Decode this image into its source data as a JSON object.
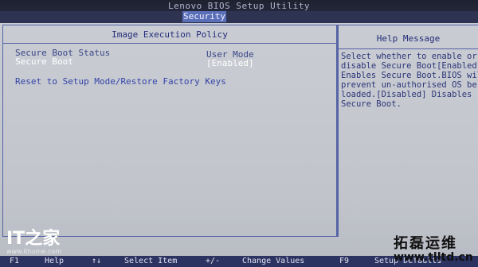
{
  "title": "Lenovo BIOS Setup Utility",
  "tab": "Security",
  "main": {
    "title": "Image Execution Policy",
    "items": [
      {
        "label": "Secure Boot Status",
        "value": "User Mode"
      },
      {
        "label": "Secure Boot",
        "value": "[Enabled]"
      },
      {
        "label": "Reset to Setup Mode/Restore Factory Keys",
        "value": ""
      }
    ]
  },
  "help": {
    "title": "Help Message",
    "text": "Select whether to enable or\ndisable Secure Boot[Enabled]\nEnables Secure Boot.BIOS wil\nprevent un-authorised OS be\nloaded.[Disabled] Disables\nSecure Boot."
  },
  "footer": {
    "f1_key": "F1",
    "f1_desc": "Help",
    "arrow_key": "↑↓",
    "arrow_desc": "Select Item",
    "pm_key": "+/-",
    "pm_desc": "Change Values",
    "f9_key": "F9",
    "f9_desc": "Setup Defaults"
  },
  "watermarks": {
    "left_logo": "IT之家",
    "left_url": "www.ithome.com",
    "right_title": "拓磊运维",
    "right_url": "www.tlltd.cn"
  }
}
